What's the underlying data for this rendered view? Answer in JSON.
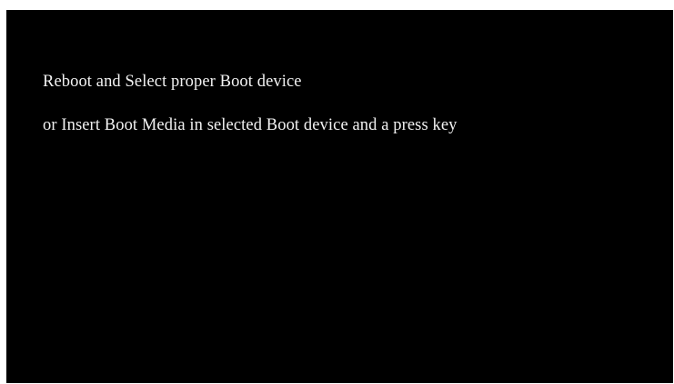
{
  "screen": {
    "background_color": "#000000",
    "text_color": "#f2f2f2",
    "lines": [
      "Reboot and Select proper Boot device",
      "or Insert Boot Media in selected Boot device and a press key"
    ]
  }
}
